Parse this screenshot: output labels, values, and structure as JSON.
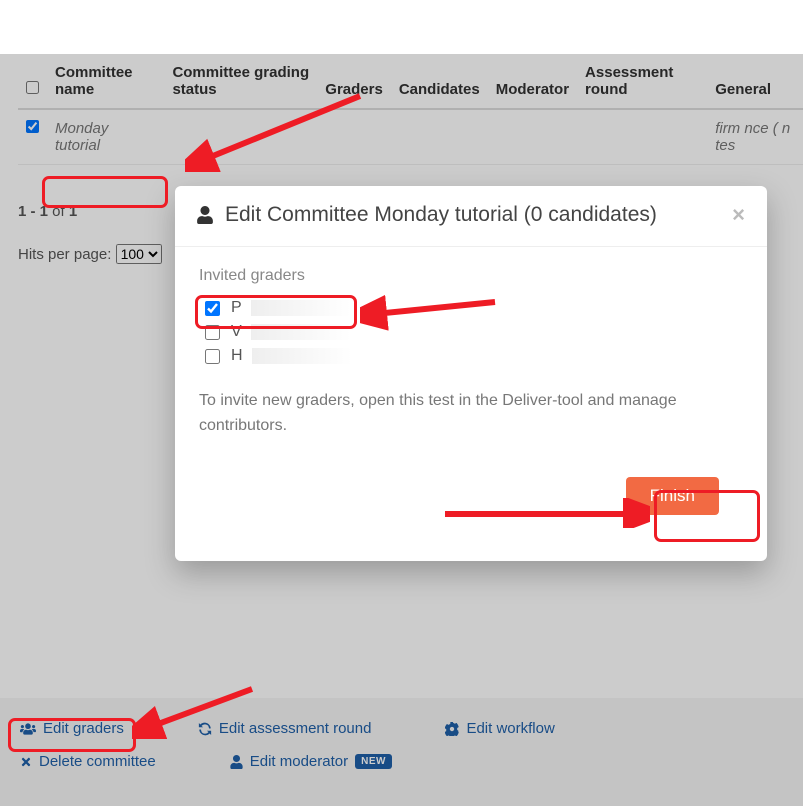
{
  "table": {
    "headers": {
      "committee_name": "Committee name",
      "grading_status": "Committee grading status",
      "graders": "Graders",
      "candidates": "Candidates",
      "moderator": "Moderator",
      "assessment_round": "Assessment round",
      "general": "General"
    },
    "rows": [
      {
        "committee_name": "Monday tutorial",
        "general_partial": "firm nce ( n tes"
      }
    ]
  },
  "pager": {
    "range_prefix": "1 - 1",
    "range_mid": " of ",
    "range_total": "1",
    "hits_label": "Hits per page: ",
    "hits_value": "100"
  },
  "actions": {
    "edit_graders": "Edit graders",
    "edit_assessment_round": "Edit assessment round",
    "edit_workflow": "Edit workflow",
    "delete_committee": "Delete committee",
    "edit_moderator": "Edit moderator",
    "new_badge": "NEW"
  },
  "modal": {
    "title": "Edit Committee Monday tutorial (0 candidates)",
    "subtitle": "Invited graders",
    "graders": [
      {
        "checked": true,
        "initial": "P"
      },
      {
        "checked": false,
        "initial": "V"
      },
      {
        "checked": false,
        "initial": "H"
      }
    ],
    "note": "To invite new graders, open this test in the Deliver-tool and manage contributors.",
    "finish": "Finish"
  }
}
